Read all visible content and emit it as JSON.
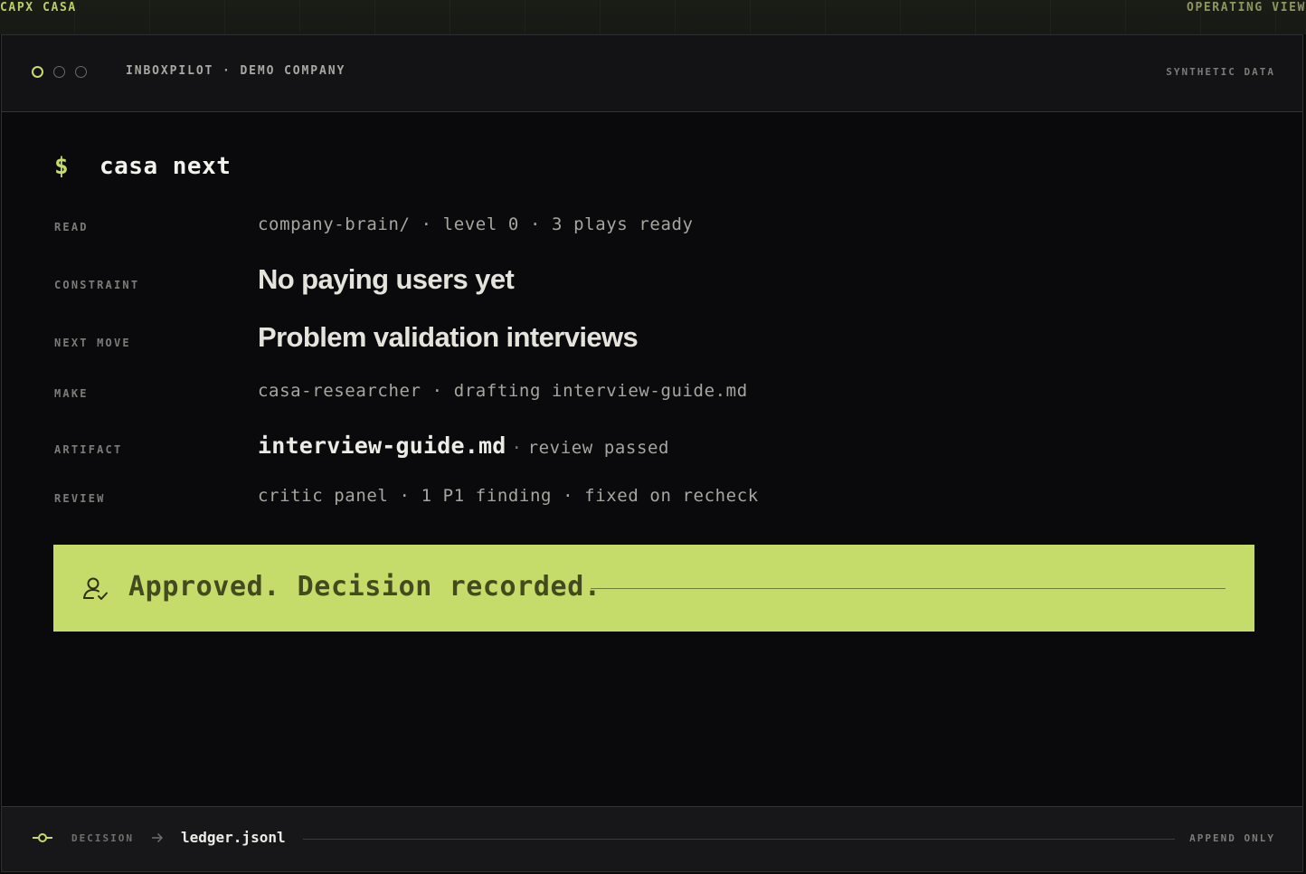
{
  "topbar": {
    "brand": "CAPX CASA",
    "view": "OPERATING VIEW"
  },
  "window": {
    "title": "INBOXPILOT · DEMO COMPANY",
    "badge": "SYNTHETIC DATA"
  },
  "terminal": {
    "prompt": "$",
    "command": "casa next",
    "rows": {
      "read": {
        "label": "READ",
        "value": "company-brain/ · level 0 · 3 plays ready"
      },
      "constraint": {
        "label": "CONSTRAINT",
        "value": "No paying users yet"
      },
      "next_move": {
        "label": "NEXT MOVE",
        "value": "Problem validation interviews"
      },
      "make": {
        "label": "MAKE",
        "value": "casa-researcher · drafting interview-guide.md"
      },
      "artifact": {
        "label": "ARTIFACT",
        "name": "interview-guide.md",
        "separator": "·",
        "status": "review passed"
      },
      "review": {
        "label": "REVIEW",
        "value": "critic panel · 1 P1 finding · fixed on recheck"
      }
    }
  },
  "banner": {
    "icon": "user-check-icon",
    "text": "Approved. Decision recorded."
  },
  "footer": {
    "icon": "commit-icon",
    "label": "DECISION",
    "arrow_icon": "arrow-right-icon",
    "file": "ledger.jsonl",
    "mode": "APPEND ONLY"
  },
  "colors": {
    "accent": "#c6dc6a",
    "background": "#0a0a0c",
    "banner_text": "#414b1f"
  }
}
